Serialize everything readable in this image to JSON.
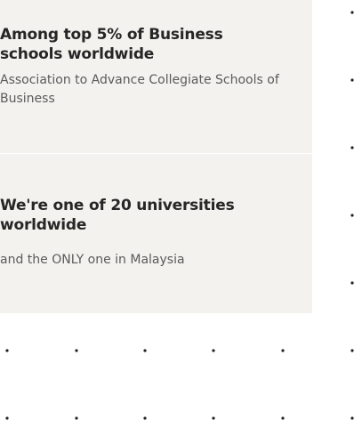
{
  "accolades": [
    {
      "heading": "Among top 5% of Business schools worldwide",
      "subtext": "Association to Advance Collegiate Schools of Business"
    },
    {
      "heading": "We're one of 20 universities worldwide",
      "subtext": "and the ONLY one in Malaysia"
    }
  ],
  "colors": {
    "panel_background": "#f3f2ef",
    "heading_text": "#262626",
    "subtext": "#5a5a5a",
    "dot": "#222222"
  }
}
